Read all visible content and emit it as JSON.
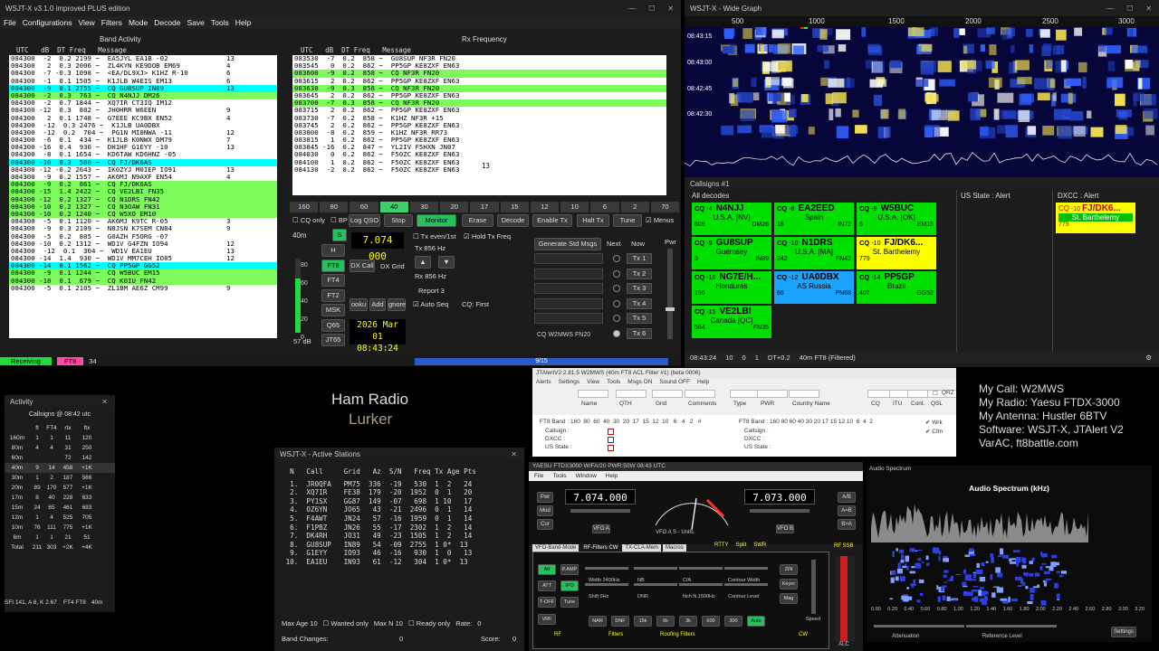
{
  "wsjt": {
    "title": "WSJT-X  v3.1.0  improved PLUS edition",
    "menu": [
      "File",
      "Configurations",
      "View",
      "Filters",
      "Mode",
      "Decode",
      "Save",
      "Tools",
      "Help"
    ],
    "band_activity_header": "Band Activity",
    "rx_header": "Rx Frequency",
    "col_header": "UTC   dB  DT Freq   Message",
    "band_rows": [
      {
        "t": "084300  -2  0.2 2199 ~  EA5JYL EA1B -02",
        "c": "",
        "n": "13"
      },
      {
        "t": "084300   2  0.3 2006 ~  ZL4KYN KE9DOB EM69",
        "c": "",
        "n": "4"
      },
      {
        "t": "084300  -7 -0.3 1098 ~  <EA/DL9XJ> K1HZ R-10",
        "c": "",
        "n": "6"
      },
      {
        "t": "084300  -1  0.1 1505 ~  K1JLB W4EIS EM13",
        "c": "",
        "n": "6"
      },
      {
        "t": "084300  -9  0.1 2755 ~  CQ GU8SUP IN89",
        "c": "me",
        "n": "13"
      },
      {
        "t": "084300  -2  0.3  763 ~  CQ N4NJJ DM26",
        "c": "cq",
        "n": ""
      },
      {
        "t": "084300  -2  0.7 1844 ~  XQ7IR CT3IQ IM12",
        "c": "",
        "n": ""
      },
      {
        "t": "084300 -12  0.3  802 ~  JH0HRR W6EEN",
        "c": "",
        "n": "9"
      },
      {
        "t": "084300   2  0.1 1748 ~  G7EEE KC9BX EN52",
        "c": "",
        "n": "4"
      },
      {
        "t": "084300  -12  0.3 2476 ~  K1JLB UA0DBX",
        "c": "",
        "n": ""
      },
      {
        "t": "084300  -12  0.2  704 ~  PG1N MI0NWA -11",
        "c": "",
        "n": "12"
      },
      {
        "t": "084300  -6  0.1  434 ~  K1JLB K0NWX DM79",
        "c": "",
        "n": "7"
      },
      {
        "t": "084300 -16  0.4  930 ~  DH1HF G1EYY -10",
        "c": "",
        "n": "13"
      },
      {
        "t": "084300  -8  0.1 1654 ~  KD6TAW KD6HNZ -05",
        "c": "",
        "n": ""
      },
      {
        "t": "084300 -10  0.3  500 ~  CQ FJ/DK6AS",
        "c": "me",
        "n": ""
      },
      {
        "t": "084300 -12 -0.2 2643 ~  IK0ZYJ M0IEP IO91",
        "c": "",
        "n": "13"
      },
      {
        "t": "084300  -9  0.2 1557 ~  AK6MJ N9AXF EN54",
        "c": "",
        "n": "4"
      },
      {
        "t": "084300  -9  0.2  861 ~  CQ FJ/DK6AS",
        "c": "cq",
        "n": ""
      },
      {
        "t": "084300 -15  1.4 2422 ~  CQ VE2LBI FN35",
        "c": "cq",
        "n": ""
      },
      {
        "t": "084300 -12  0.2 1327 ~  CQ N1DRS FN42",
        "c": "cq",
        "n": ""
      },
      {
        "t": "084300 -10  0.2 1327 ~  CQ N3OAW FN31",
        "c": "cq",
        "n": ""
      },
      {
        "t": "084300 -10  0.2 1240 ~  CQ W5XO EM10",
        "c": "cq",
        "n": ""
      },
      {
        "t": "084300  -5  0.1 1120 ~  AK6MJ K9TC R-05",
        "c": "",
        "n": "3"
      },
      {
        "t": "084300  -9  0.3 2109 ~  N8JSN K7SEM CN84",
        "c": "",
        "n": "9"
      },
      {
        "t": "084300  -5  0.2  805 ~  G0AZH F5ORG -07",
        "c": "",
        "n": ""
      },
      {
        "t": "084300 -10  0.2 1312 ~  WD1V G4FZN IO94",
        "c": "",
        "n": "12"
      },
      {
        "t": "084300  -12  0.1  304 ~  WD1V EA1EU",
        "c": "",
        "n": "13"
      },
      {
        "t": "084300 -14  1.4  930 ~  WD1V MM7CEH IO85",
        "c": "",
        "n": "12"
      },
      {
        "t": "084300 -14  0.1 1562 ~  CQ PP5GP GG52",
        "c": "me",
        "n": ""
      },
      {
        "t": "084300  -9  0.1 1244 ~  CQ W5BUC EM15",
        "c": "cq",
        "n": ""
      },
      {
        "t": "084300 -10  0.1  679 ~  CQ K0IU FN42",
        "c": "cq",
        "n": ""
      },
      {
        "t": "084300  -5  0.1 2105 ~  ZL1BM AE6Z CM99",
        "c": "",
        "n": "9"
      }
    ],
    "rx_rows": [
      {
        "t": "083530  -7  0.2  858 ~  GU8SUP NF3R FN20",
        "c": ""
      },
      {
        "t": "083545   0  0.2  862 ~  PP5GP KE8ZXF EN63",
        "c": ""
      },
      {
        "t": "083600  -9  0.2  858 ~  CQ NF3R FN20",
        "c": "cq"
      },
      {
        "t": "083615   2  0.2  862 ~  PP5GP KE8ZXF EN63",
        "c": ""
      },
      {
        "t": "083630  -9  0.3  858 ~  CQ NF3R FN20",
        "c": "cq"
      },
      {
        "t": "083645   2  0.2  862 ~  PP5GP KE8ZXF EN63",
        "c": ""
      },
      {
        "t": "083700  -7  0.3  858 ~  CQ NF3R FN20",
        "c": "cq"
      },
      {
        "t": "083715   2  0.2  862 ~  PP5GP KE8ZXF EN63",
        "c": ""
      },
      {
        "t": "083730  -7  0.2  858 ~  K1HZ NF3R +15",
        "c": ""
      },
      {
        "t": "083745   2  0.2  862 ~  PP5GP KE8ZXF EN63",
        "c": ""
      },
      {
        "t": "083800  -8  0.2  859 ~  K1HZ NF3R RR73",
        "c": ""
      },
      {
        "t": "083815   1  0.2  862 ~  PP5GP KE8ZXF EN63",
        "c": ""
      },
      {
        "t": "083845 -16  0.2  847 ~  YL2IV F5HXN JN07",
        "c": ""
      },
      {
        "t": "084030   0  0.2  862 ~  F50ZC KE8ZXF EN63",
        "c": ""
      },
      {
        "t": "084100   1  0.2  862 ~  F50ZC KE8ZXF EN63",
        "c": ""
      },
      {
        "t": "084130  -2  0.2  862 ~  F50ZC KE8ZXF EN63",
        "c": ""
      }
    ],
    "rx_note": "13",
    "bands": [
      "160",
      "80",
      "60",
      "40",
      "30",
      "20",
      "17",
      "15",
      "12",
      "10",
      "6",
      "2",
      "70"
    ],
    "selected_band": "40",
    "buttons": {
      "cq_only": "CQ only",
      "bp": "BP",
      "log_qso": "Log QSO",
      "stop": "Stop",
      "monitor": "Monitor",
      "erase": "Erase",
      "decode": "Decode",
      "enable_tx": "Enable Tx",
      "halt_tx": "Halt Tx",
      "tune": "Tune",
      "menus": "Menus"
    },
    "band_select": "40m",
    "freq": "7.074 000",
    "modes": [
      "H",
      "FT8",
      "FT4",
      "FT2",
      "MSK",
      "Q65",
      "JT65"
    ],
    "mode_row2": [
      "DX Call",
      "DX Grid"
    ],
    "lookup": [
      "ooku",
      "Add",
      "gnore"
    ],
    "tx_even": "Tx even/1st",
    "hold_tx": "Hold Tx Freq",
    "tx_hz": "Tx  856 Hz",
    "rx_hz": "Rx  856 Hz",
    "report": "Report  3",
    "auto_seq": "Auto Seq",
    "cq_first": "CQ: First",
    "date": "2026 Mar 01",
    "time": "08:43:24",
    "db": "57 dB",
    "gen_msgs": "Generate Std Msgs",
    "next": "Next",
    "now": "Now",
    "pwr": "Pwr",
    "tx_buttons": [
      "Tx 1",
      "Tx 2",
      "Tx 3",
      "Tx 4",
      "Tx 5",
      "Tx 6"
    ],
    "tx6_msg": "CQ W2MWS FN20",
    "scale": [
      "80",
      "60",
      "40",
      "20",
      "0"
    ],
    "status": {
      "receiving": "Receiving",
      "mode": "FT8",
      "num": "34",
      "progress": "9/15"
    }
  },
  "wide": {
    "title": "WSJT-X - Wide Graph",
    "axis": [
      "500",
      "1000",
      "1500",
      "2000",
      "2500",
      "3000"
    ],
    "times": [
      "08:43:15",
      "08:43:00",
      "08:42:45",
      "08:42:30"
    ],
    "status": {
      "time": "08:43:24",
      "n1": "10",
      "n2": "0",
      "n3": "1",
      "dt": "DT+0.2",
      "band": "40m FT8 (Filtered)"
    }
  },
  "calls": {
    "title": "Callsigns #1",
    "all_decodes": "All decodes",
    "us_state": "US State : Alert",
    "dxcc": "DXCC : Alert",
    "boxes": [
      {
        "db": "-4",
        "call": "N4NJJ",
        "ent": "U.S.A. [NV]",
        "n": "609",
        "grid": "DM26",
        "bg": "#00e000"
      },
      {
        "db": "-8",
        "call": "EA2EED",
        "ent": "Spain",
        "n": "18",
        "grid": "IN72",
        "bg": "#00e000"
      },
      {
        "db": "-9",
        "call": "W5BUC",
        "ent": "U.S.A. [OK]",
        "n": "6",
        "grid": "EM15",
        "bg": "#00e000"
      },
      {
        "db": "-9",
        "call": "GU8SUP",
        "ent": "Guernsey",
        "n": "3",
        "grid": "IN89",
        "bg": "#00e000"
      },
      {
        "db": "-10",
        "call": "N1DRS",
        "ent": "U.S.A. [MA]",
        "n": "242",
        "grid": "FN42",
        "bg": "#00e000"
      },
      {
        "db": "-10",
        "call": "FJ/DK6...",
        "ent": "St. Barthelemy",
        "n": "779",
        "grid": "",
        "bg": "#ffff00"
      },
      {
        "db": "-10",
        "call": "NG7E/H...",
        "ent": "Honduras",
        "n": "196",
        "grid": "",
        "bg": "#00e000"
      },
      {
        "db": "-12",
        "call": "UA0DBX",
        "ent": "AS Russia",
        "n": "66",
        "grid": "PN68",
        "bg": "#1aa3ff"
      },
      {
        "db": "-14",
        "call": "PP5GP",
        "ent": "Brazil",
        "n": "407",
        "grid": "GG52",
        "bg": "#00e000"
      },
      {
        "db": "-15",
        "call": "VE2LBI",
        "ent": "Canada [QC]",
        "n": "564",
        "grid": "FN35",
        "bg": "#00e000"
      }
    ],
    "dxcc_box": {
      "db": "-10",
      "call": "FJ/DK6...",
      "ent": "St. Barthelemy",
      "n": "779"
    }
  },
  "activity": {
    "title": "Activity",
    "subtitle": "Callsigns @ 08:42 utc",
    "header": [
      "",
      "ft",
      "FT4",
      "rtx",
      "ftx"
    ],
    "rows": [
      [
        "160m",
        "1",
        "1",
        "11",
        "120"
      ],
      [
        "80m",
        "4",
        "4",
        "31",
        "250"
      ],
      [
        "60m",
        "",
        "",
        "72",
        "142"
      ],
      [
        "40m",
        "9",
        "14",
        "458",
        "+1K"
      ],
      [
        "30m",
        "1",
        "2",
        "187",
        "566"
      ],
      [
        "20m",
        "89",
        "170",
        "577",
        "+1K"
      ],
      [
        "17m",
        "8",
        "40",
        "228",
        "633"
      ],
      [
        "15m",
        "24",
        "65",
        "461",
        "693"
      ],
      [
        "12m",
        "1",
        "4",
        "525",
        "705"
      ],
      [
        "10m",
        "76",
        "111",
        "775",
        "+1K"
      ],
      [
        "6m",
        "1",
        "1",
        "21",
        "51"
      ],
      [
        "Total",
        "211",
        "303",
        "+2K",
        "+4K"
      ]
    ],
    "footer": "SFI 141, A 8, K 2.67",
    "footer_mode": "FT4  FT8",
    "footer_band": "40m"
  },
  "overlay": {
    "title": "Ham Radio",
    "subtitle": "Lurker"
  },
  "active": {
    "title": "WSJT-X - Active Stations",
    "header": "  N   Call     Grid   Az  S/N   Freq Tx Age Pts",
    "rows": [
      "  1.  JR0QFA   PM75  336  -19   530  1  2   24",
      "  2.  XQ7IR    FE38  179  -20  1952  0  1   20",
      "  3.  PY1SX    GG87  149  -07   698  1 10   17",
      "  4.  OZ6YN    JO65   43  -21  2496  0  1   14",
      "  5.  F4AWT    JN24   57  -16  1959  0  1   14",
      "  6.  F1PBZ    JN26   55  -17  2302  1  2   14",
      "  7.  DK4RH    JO31   49  -23  1505  1  2   14",
      "  8.  GU8SUP   IN89   54  -09  2755  1 0*  13",
      "  9.  G1EYY    IO93   46  -16   930  1  0   13",
      " 10.  EA1EU    IN93   61  -12   304  1 0*  13"
    ],
    "max_age": "Max Age  10",
    "wanted": "Wanted only",
    "max_n": "Max N  10",
    "ready": "Ready only",
    "rate": "Rate:",
    "rate_v": "0",
    "band_changes": "Band Changes:",
    "band_changes_v": "0",
    "score": "Score:",
    "score_v": "0"
  },
  "jtalert": {
    "title": "JTAlertV2  2.81.5  W2MWS  (40m FT8 ACL Filter #1)  (beta 0006)",
    "menu": [
      "Alerts",
      "Settings",
      "View",
      "Tools",
      "Msgs ON",
      "Sound OFF",
      "Help"
    ],
    "cols": [
      "Name",
      "QTH",
      "Grid",
      "Comments",
      "Type",
      "PWR",
      "Country Name",
      "CQ",
      "ITU",
      "Cont.",
      "QSL"
    ],
    "qrz": "QRZ",
    "ft8band": "FT8 Band : 160  80  60  40  30  20  17  15  12  10   6   4   2   #",
    "ft8band_r": "FT8 Band : 160 80 60 40 30 20 17 15 12 10  6  4  2",
    "labels_l": [
      "Callsign :",
      "DXCC :",
      "US State :"
    ],
    "labels_r": [
      "Callsign :",
      "DXCC :",
      "US State :"
    ],
    "wrk": "Wrk",
    "cfm": "Cfm"
  },
  "radio": {
    "title": "YAESU FTDX3000 W/FA/20 PWR:50W  08:43 UTC",
    "menu": [
      "File",
      "Tools",
      "Window",
      "Help"
    ],
    "vfoa": "7.074.000",
    "vfob": "7.073.000",
    "vfoa_lbl": "VFO A",
    "vfob_lbl": "VFO B",
    "meter": "VFO A S - Units",
    "left_btns": [
      "Pwr",
      "Mod",
      "Cur"
    ],
    "right_btns": [
      "A/B",
      "A=B",
      "B>A"
    ],
    "tabs": [
      "VFO-Band-Mode",
      "RF-Filters CW",
      "TX-CLA-Mem",
      "Macros"
    ],
    "rf_btns": [
      "Att",
      "P.AMP",
      "ATT",
      "IPO",
      "T-OFF",
      "Tune",
      "VRF"
    ],
    "filters": [
      "Width 2400Hz",
      "Shift 0Hz",
      "NB",
      "DNR",
      "C/A",
      "Nch N 1500Hz",
      "Contour Width",
      "Contour Level"
    ],
    "bottom": [
      "NAR",
      "DNF",
      "15k",
      "6k",
      "3k",
      "600",
      "300",
      "Auto"
    ],
    "group_lbls": [
      "RF",
      "Filters",
      "Roofing Filters",
      "CW"
    ],
    "cw_btns": [
      "ZIN",
      "Keyer",
      "Mag"
    ],
    "speed": "Speed",
    "rf_ssb": "RF SSB",
    "alc": "ALC",
    "rtty": "RTTY",
    "split": "Split",
    "swr": "SWR"
  },
  "spec": {
    "title": "Audio Spectrum",
    "header": "Audio Spectrum (kHz)",
    "axis": [
      "0.00",
      "0.20",
      "0.40",
      "0.60",
      "0.80",
      "1.00",
      "1.20",
      "1.40",
      "1.60",
      "1.80",
      "2.00",
      "2.20",
      "2.40",
      "2.60",
      "2.80",
      "3.00",
      "3.20"
    ],
    "attenuation": "Attenuation",
    "ref_level": "Reference Level",
    "settings": "Settings"
  },
  "info": [
    "My Call: W2MWS",
    "My Radio: Yaesu FTDX-3000",
    "My Antenna: Hustler 6BTV",
    "Software: WSJT-X, JTAlert V2",
    "VarAC, ft8battle.com"
  ]
}
